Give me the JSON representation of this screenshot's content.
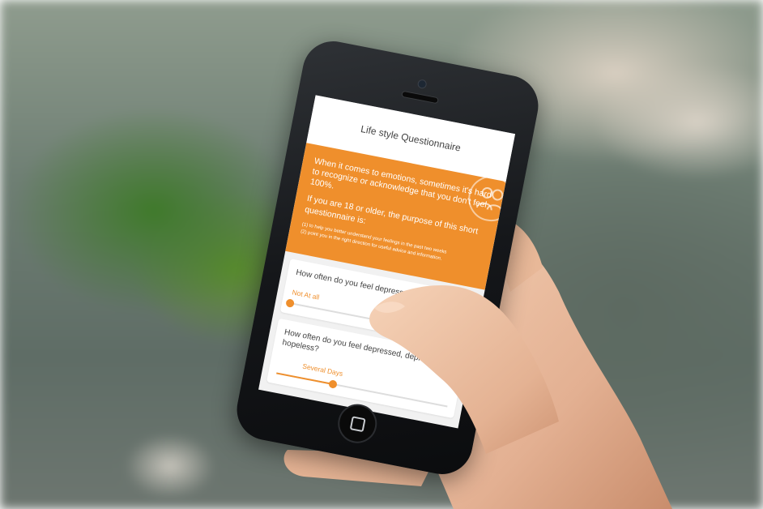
{
  "app": {
    "title": "Life style Questionnaire"
  },
  "intro": {
    "paragraph1": "When it comes to emotions, sometimes it's hard to recognize or acknowledge that you don't feel 100%.",
    "paragraph2": "If you are 18 or older, the purpose of this short questionnaire is:",
    "point1": "(1) to help you better understand your feelings in the past two weeks",
    "point2": "(2) point you in the right direction for useful advice and information.",
    "icon": "people-icon"
  },
  "questions": [
    {
      "text": "How often do you feel depressed or hopeless?",
      "answer": "Not At all",
      "value": 0
    },
    {
      "text": "How often do you feel depressed, depressed or hopeless?",
      "answer": "Several Days",
      "value": 0.33
    }
  ],
  "colors": {
    "accent": "#ef8f2c",
    "header_bg": "#ffffff"
  }
}
